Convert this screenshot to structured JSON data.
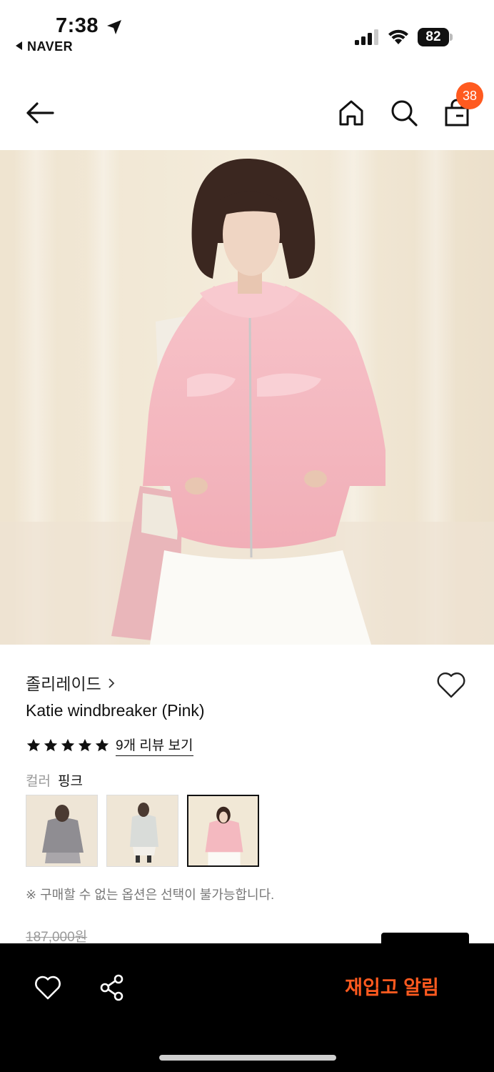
{
  "status_bar": {
    "time": "7:38",
    "back_app": "NAVER",
    "battery": "82",
    "icons": [
      "location-arrow-icon",
      "signal-icon",
      "wifi-icon",
      "battery-icon"
    ]
  },
  "header": {
    "icons": [
      "back-arrow-icon",
      "home-icon",
      "search-icon",
      "shopping-bag-icon"
    ],
    "cart_count": "38"
  },
  "product": {
    "brand": "졸리레이드",
    "name": "Katie windbreaker (Pink)",
    "rating": 5,
    "review_link": "9개 리뷰 보기",
    "option_label": "컬러",
    "option_value": "핑크",
    "swatches": [
      {
        "color": "gray",
        "selected": false
      },
      {
        "color": "light-gray",
        "selected": false
      },
      {
        "color": "pink",
        "selected": true
      }
    ],
    "notice": "※ 구매할 수 없는 옵션은 선택이 불가능합니다.",
    "original_price": "187,000원"
  },
  "bottom_bar": {
    "icons": [
      "heart-icon",
      "share-icon"
    ],
    "restock_label": "재입고 알림"
  },
  "colors": {
    "accent": "#ff5a1f",
    "bottom_bar_bg": "#000000",
    "jacket_pink": "#f4b9c0",
    "background_cream": "#f1e7d4"
  }
}
